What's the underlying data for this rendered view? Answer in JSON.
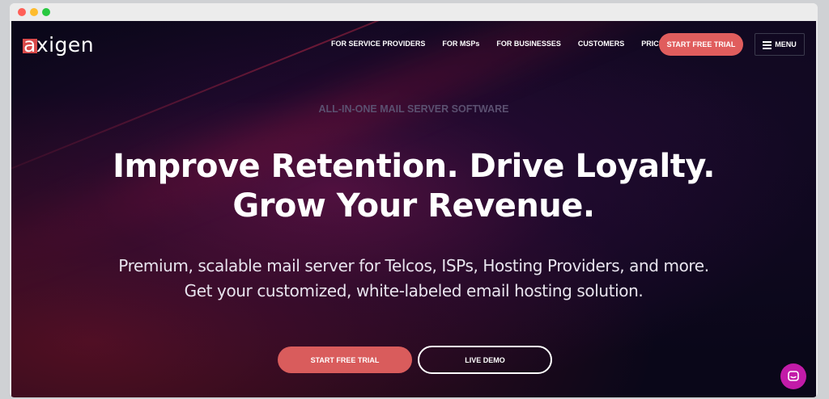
{
  "brand": {
    "name": "axigen",
    "accent_color": "#d84a4a"
  },
  "nav": {
    "links": [
      "FOR SERVICE PROVIDERS",
      "FOR MSPs",
      "FOR BUSINESSES",
      "CUSTOMERS",
      "PRICING"
    ],
    "cta_label": "START FREE TRIAL",
    "menu_label": "MENU"
  },
  "hero": {
    "eyebrow": "ALL-IN-ONE MAIL SERVER SOFTWARE",
    "headline_line1": "Improve Retention. Drive Loyalty.",
    "headline_line2": "Grow Your Revenue.",
    "sub_line1": "Premium, scalable mail server for Telcos, ISPs, Hosting Providers, and more.",
    "sub_line2": "Get your customized, white-labeled email hosting solution.",
    "primary_button": "START FREE TRIAL",
    "secondary_button": "LIVE DEMO"
  },
  "chat": {
    "icon": "chat-icon",
    "color": "#c21ba8"
  },
  "colors": {
    "cta": "#e05d5d",
    "background": "#0a0719"
  }
}
